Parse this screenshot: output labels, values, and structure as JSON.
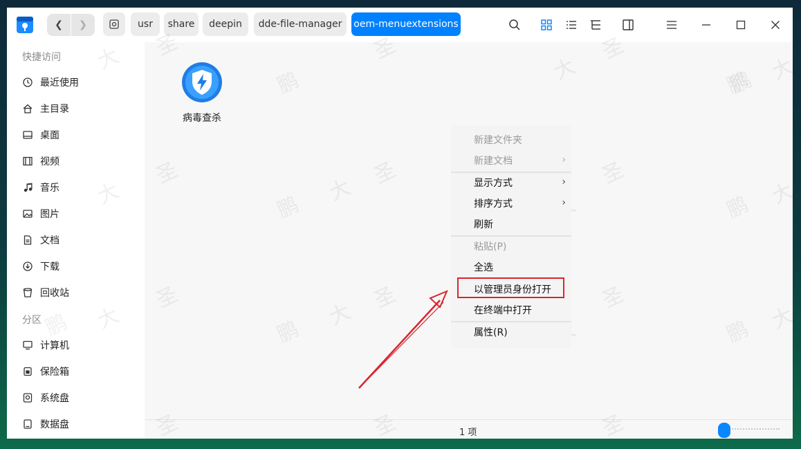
{
  "breadcrumbs": [
    "usr",
    "share",
    "deepin",
    "dde-file-manager",
    "oem-menuextensions"
  ],
  "sidebar": {
    "quick_access_header": "快捷访问",
    "quick_items": [
      "最近使用",
      "主目录",
      "桌面",
      "视频",
      "音乐",
      "图片",
      "文档",
      "下载",
      "回收站"
    ],
    "partition_header": "分区",
    "partition_items": [
      "计算机",
      "保险箱",
      "系统盘",
      "数据盘"
    ]
  },
  "file": {
    "name": "病毒查杀"
  },
  "status": {
    "item_count": "1 项",
    "zoom_level": 0.1
  },
  "context_menu": {
    "items": [
      {
        "label": "新建文件夹",
        "enabled": false
      },
      {
        "label": "新建文档",
        "enabled": false,
        "submenu": true
      },
      {
        "label": "显示方式",
        "enabled": true,
        "submenu": true
      },
      {
        "label": "排序方式",
        "enabled": true,
        "submenu": true
      },
      {
        "label": "刷新",
        "enabled": true
      },
      {
        "label": "粘贴(P)",
        "enabled": false
      },
      {
        "label": "全选",
        "enabled": true
      },
      {
        "label": "以管理员身份打开",
        "enabled": true,
        "highlighted": true
      },
      {
        "label": "在终端中打开",
        "enabled": true
      },
      {
        "label": "属性(R)",
        "enabled": true
      }
    ]
  },
  "colors": {
    "accent": "#0081ff",
    "annotation": "#d9252d"
  },
  "watermark": [
    "大",
    "鹏",
    "圣"
  ]
}
